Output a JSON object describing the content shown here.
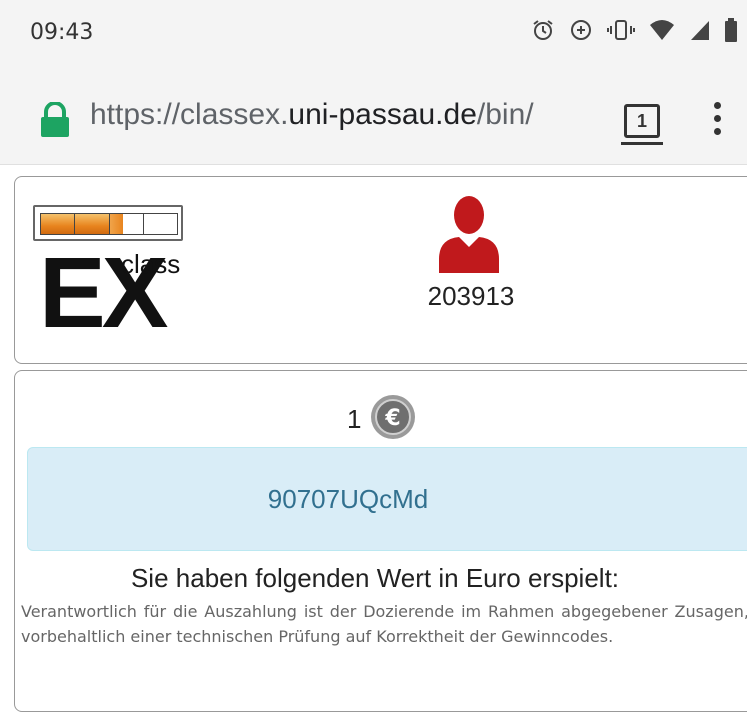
{
  "status_bar": {
    "time": "09:43",
    "icons": [
      "alarm-icon",
      "data-saver-icon",
      "vibrate-icon",
      "wifi-icon",
      "signal-icon",
      "battery-icon"
    ]
  },
  "browser": {
    "url_prefix": "https://classex.",
    "url_domain": "uni-passau.de",
    "url_suffix": "/bin/",
    "tab_count": "1",
    "lock_color": "#1da462"
  },
  "header": {
    "logo_text_main": "EX",
    "logo_text_class": "class",
    "progress_fraction": 0.6,
    "user_id": "203913",
    "avatar_color": "#c0191c"
  },
  "content": {
    "coin_count": "1",
    "code": "90707UQcMd",
    "result_heading": "Sie haben folgenden Wert in Euro erspielt:",
    "disclaimer": "Verantwortlich für die Auszahlung ist der Dozierende im Rahmen abgegebener Zusagen, vorbehaltlich einer technischen Prüfung auf Korrektheit der Gewinncodes."
  }
}
